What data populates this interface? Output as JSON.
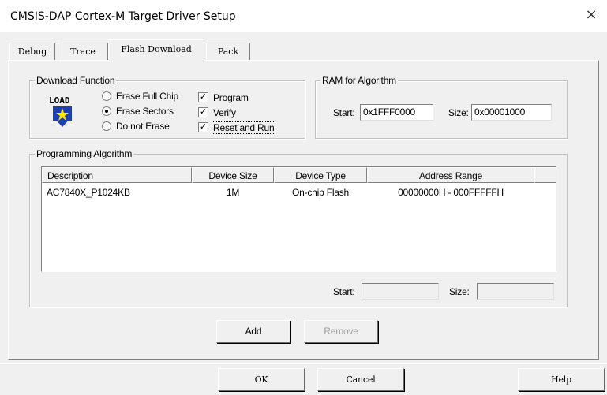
{
  "window": {
    "title": "CMSIS-DAP Cortex-M Target Driver Setup",
    "close_glyph": "×"
  },
  "tabs": [
    {
      "label": "Debug",
      "active": false
    },
    {
      "label": "Trace",
      "active": false
    },
    {
      "label": "Flash Download",
      "active": true
    },
    {
      "label": "Pack",
      "active": false
    }
  ],
  "download_function": {
    "group_label": "Download Function",
    "icon": "load-icon",
    "icon_text": "LOAD",
    "radios": [
      {
        "label": "Erase Full Chip",
        "checked": false
      },
      {
        "label": "Erase Sectors",
        "checked": true
      },
      {
        "label": "Do not Erase",
        "checked": false
      }
    ],
    "checkboxes": [
      {
        "label": "Program",
        "checked": true
      },
      {
        "label": "Verify",
        "checked": true
      },
      {
        "label": "Reset and Run",
        "checked": true
      }
    ],
    "check_glyph": "✓"
  },
  "ram_for_algorithm": {
    "group_label": "RAM for Algorithm",
    "start_label": "Start:",
    "start_value": "0x1FFF0000",
    "size_label": "Size:",
    "size_value": "0x00001000"
  },
  "programming_algorithm": {
    "group_label": "Programming Algorithm",
    "columns": [
      "Description",
      "Device Size",
      "Device Type",
      "Address Range"
    ],
    "rows": [
      {
        "description": "AC7840X_P1024KB",
        "device_size": "1M",
        "device_type": "On-chip Flash",
        "address_range": "00000000H - 000FFFFFH"
      }
    ],
    "start_label": "Start:",
    "start_value": "",
    "size_label": "Size:",
    "size_value": ""
  },
  "actions": {
    "add_label": "Add",
    "remove_label": "Remove"
  },
  "footer": {
    "ok_label": "OK",
    "cancel_label": "Cancel",
    "help_label": "Help"
  }
}
